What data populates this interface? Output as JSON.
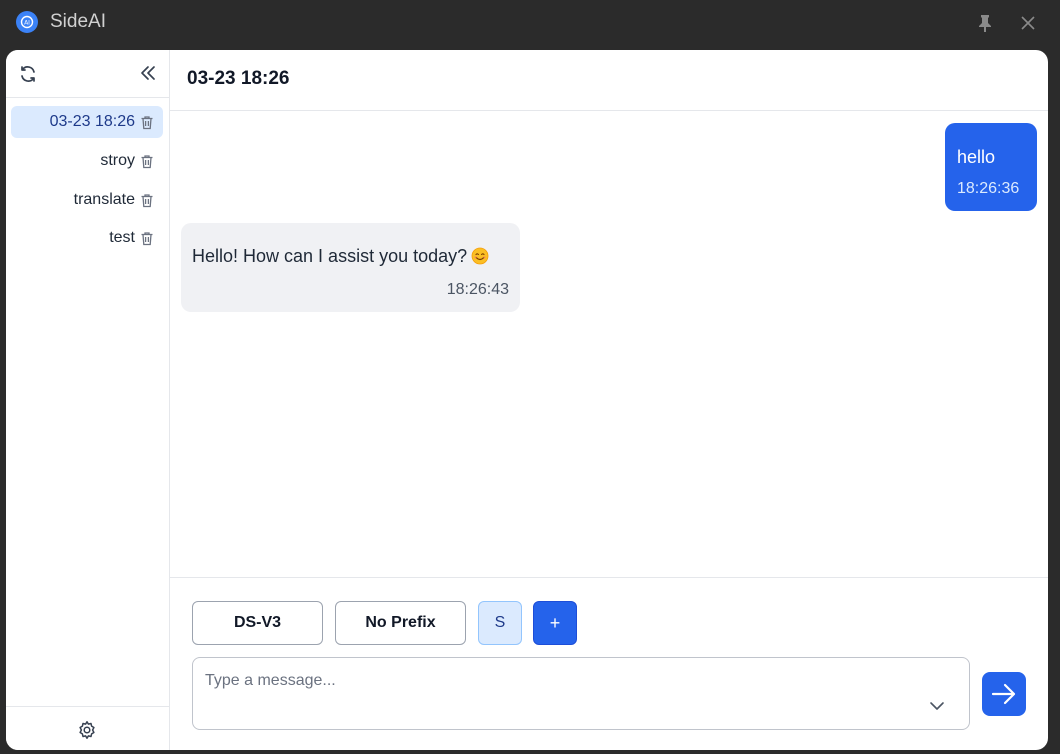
{
  "app": {
    "title": "SideAI"
  },
  "sidebar": {
    "sessions": [
      {
        "label": "03-23 18:26",
        "active": true
      },
      {
        "label": "stroy",
        "active": false
      },
      {
        "label": "translate",
        "active": false
      },
      {
        "label": "test",
        "active": false
      }
    ]
  },
  "chat": {
    "title": "03-23 18:26",
    "messages": [
      {
        "role": "user",
        "text": "hello",
        "time": "18:26:36"
      },
      {
        "role": "assistant",
        "text": "Hello! How can I assist you today?",
        "emoji": "smiling-face-icon",
        "time": "18:26:43"
      }
    ]
  },
  "composer": {
    "model_label": "DS-V3",
    "prefix_label": "No Prefix",
    "s_label": "S",
    "add_label": "+",
    "placeholder": "Type a message..."
  },
  "colors": {
    "accent": "#2563eb",
    "active_session_bg": "#dbeafe",
    "assistant_bubble_bg": "#f0f1f4",
    "titlebar_bg": "#2b2b2b"
  }
}
